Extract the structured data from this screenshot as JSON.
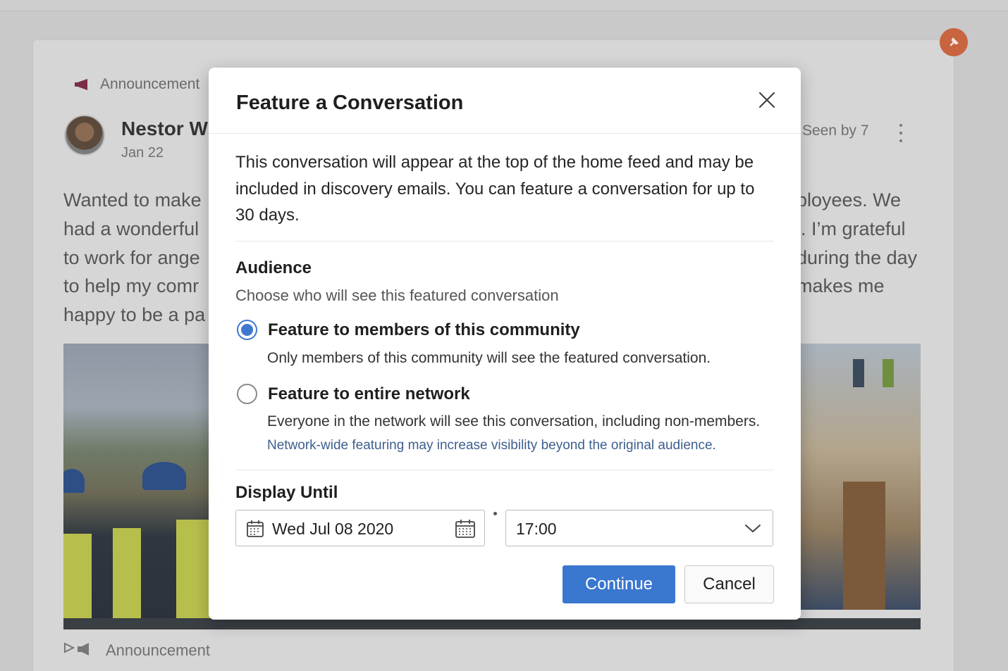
{
  "background": {
    "announcement_top": "Announcement",
    "author_name": "Nestor W",
    "post_date": "Jan 22",
    "seen_by": "Seen by 7",
    "post_lines_left": [
      "Wanted to make",
      "had a wonderful",
      "to work for ange",
      "to help my comr",
      "happy to be a pa"
    ],
    "post_lines_right": [
      "ployees. We",
      "l. I’m grateful",
      "during the day",
      "makes me"
    ],
    "announcement_bottom": "Announcement",
    "pin_color": "#c8643f"
  },
  "dialog": {
    "title": "Feature a Conversation",
    "description": "This conversation will appear at the top of the home feed and may be included in discovery emails. You can feature a conversation for up to 30 days.",
    "audience": {
      "heading": "Audience",
      "subheading": "Choose who will see this featured conversation",
      "options": [
        {
          "label": "Feature to members of this community",
          "help": "Only members of this community will see the featured conversation.",
          "selected": true
        },
        {
          "label": "Feature to entire network",
          "help": "Everyone in the network will see this conversation, including non-members.",
          "selected": false
        }
      ],
      "network_note": "Network-wide featuring may increase visibility beyond the original audience."
    },
    "display_until": {
      "heading": "Display Until",
      "date": "Wed Jul 08 2020",
      "time": "17:00"
    },
    "buttons": {
      "continue": "Continue",
      "cancel": "Cancel"
    },
    "colors": {
      "primary": "#3a77cf",
      "radio_selected": "#3f78d0"
    }
  }
}
